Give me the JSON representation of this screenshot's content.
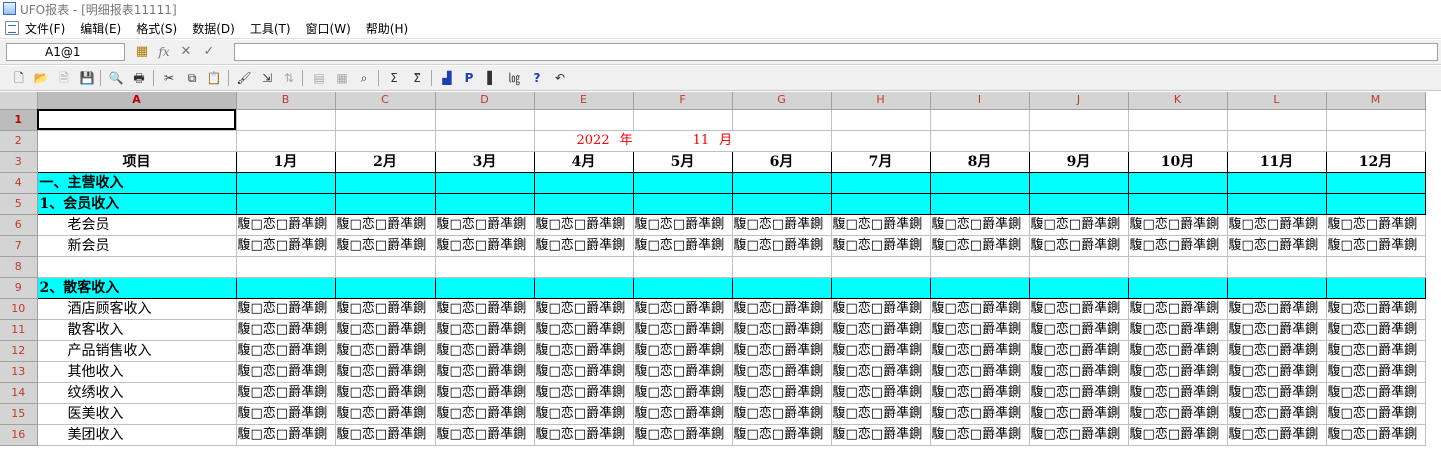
{
  "window": {
    "title": "UFO报表 - [明细报表11111]"
  },
  "menu": [
    "文件(F)",
    "编辑(E)",
    "格式(S)",
    "数据(D)",
    "工具(T)",
    "窗口(W)",
    "帮助(H)"
  ],
  "formula_bar": {
    "cell_ref": "A1@1",
    "value": ""
  },
  "sheet": {
    "columns": [
      "A",
      "B",
      "C",
      "D",
      "E",
      "F",
      "G",
      "H",
      "I",
      "J",
      "K",
      "L",
      "M"
    ],
    "rows": [
      "1",
      "2",
      "3",
      "4",
      "5",
      "6",
      "7",
      "8",
      "9",
      "10",
      "11",
      "12",
      "13",
      "14",
      "15",
      "16"
    ],
    "active_cell": "A1",
    "date_row": {
      "year": "2022",
      "year_unit": "年",
      "month": "11",
      "month_unit": "月"
    },
    "header": {
      "item": "项目",
      "months": [
        "1月",
        "2月",
        "3月",
        "4月",
        "5月",
        "6月",
        "7月",
        "8月",
        "9月",
        "10月",
        "11月",
        "12月"
      ]
    },
    "section_main": "一、主营收入",
    "section_member": "1、会员收入",
    "member_items": [
      "老会员",
      "新会员"
    ],
    "section_walkin": "2、散客收入",
    "walkin_items": [
      "酒店顾客收入",
      "散客收入",
      "产品销售收入",
      "其他收入",
      "纹绣收入",
      "医美收入",
      "美团收入"
    ],
    "garbled_cell": "䮡□恋□爵凖鍘"
  }
}
